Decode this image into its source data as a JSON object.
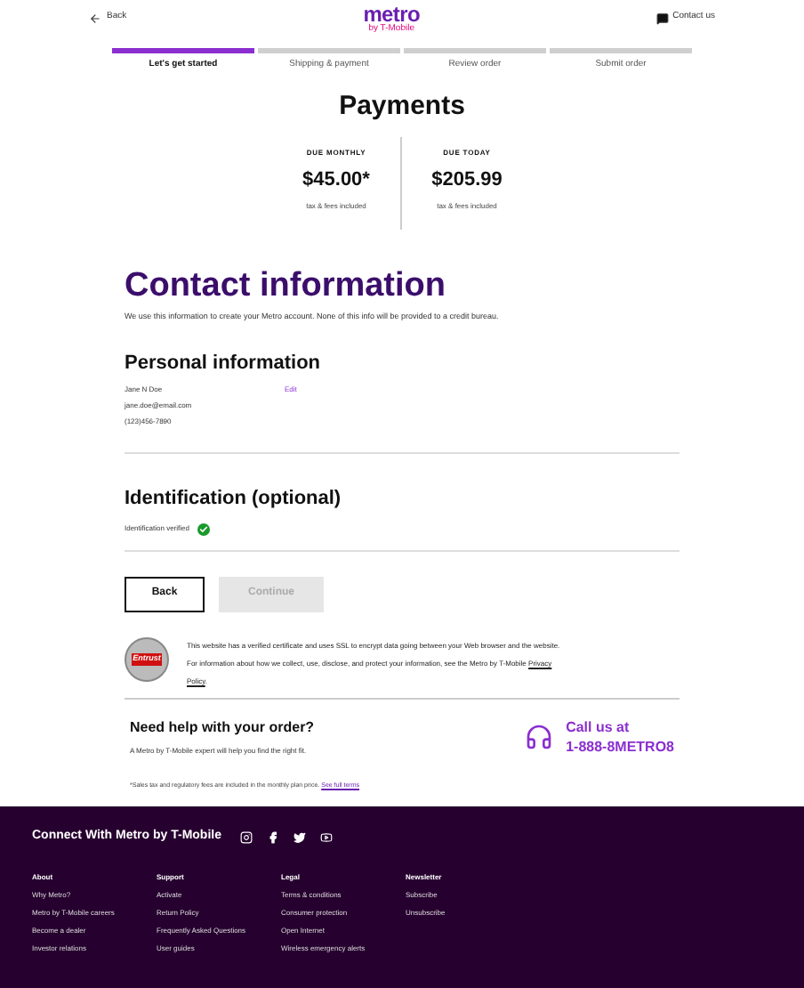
{
  "header": {
    "back": "Back",
    "logo": "metro",
    "logo_sub": "by T-Mobile",
    "contact": "Contact us"
  },
  "steps": [
    {
      "label": "Let's get started",
      "selected": true
    },
    {
      "label": "Shipping & payment",
      "selected": false
    },
    {
      "label": "Review order",
      "selected": false
    },
    {
      "label": "Submit order",
      "selected": false
    }
  ],
  "payments": {
    "title": "Payments",
    "dues": [
      {
        "label": "DUE MONTHLY",
        "amount": "$45.00*",
        "note": "tax & fees included"
      },
      {
        "label": "DUE TODAY",
        "amount": "$205.99",
        "note": "tax & fees included"
      }
    ]
  },
  "contact": {
    "title": "Contact information",
    "description": "We use this information to create your Metro account. None of this info will be provided to a credit bureau."
  },
  "personal": {
    "title": "Personal information",
    "lines": [
      "Jane N Doe",
      "jane.doe@email.com",
      "(123)456-7890"
    ],
    "edit": "Edit"
  },
  "identification": {
    "title": "Identification (optional)",
    "status": "Identification verified",
    "verified": true
  },
  "buttons": [
    {
      "label": "Back",
      "disabled": false
    },
    {
      "label": "Continue",
      "disabled": true
    }
  ],
  "security": {
    "badge": "Entrust",
    "text1": "This website has a verified certificate and uses SSL to encrypt data going between your Web browser and the website.",
    "text2": "For information about how we collect, use, disclose, and protect your information, see the Metro by T-Mobile",
    "link": "Privacy Policy",
    "end": "."
  },
  "help": {
    "title": "Need help with your order?",
    "subtitle": "A Metro by T-Mobile expert will help you find the right fit.",
    "call1": "Call us at",
    "call2": "1-888-8METRO8"
  },
  "footnote": {
    "text": "*Sales tax and regulatory fees are included in the monthly plan price.",
    "link": "See full terms"
  },
  "footer": {
    "title": "Connect With Metro by T-Mobile",
    "columns": [
      {
        "heading": "About",
        "items": [
          "Why Metro?",
          "Metro by T-Mobile careers",
          "Become a dealer",
          "Investor relations"
        ]
      },
      {
        "heading": "Support",
        "items": [
          "Activate",
          "Return Policy",
          "Frequently Asked Questions",
          "User guides"
        ]
      },
      {
        "heading": "Legal",
        "items": [
          "Terms & conditions",
          "Consumer protection",
          "Open Internet",
          "Wireless emergency alerts"
        ]
      },
      {
        "heading": "Newsletter",
        "items": [
          "Subscribe",
          "Unsubscribe"
        ]
      }
    ]
  }
}
